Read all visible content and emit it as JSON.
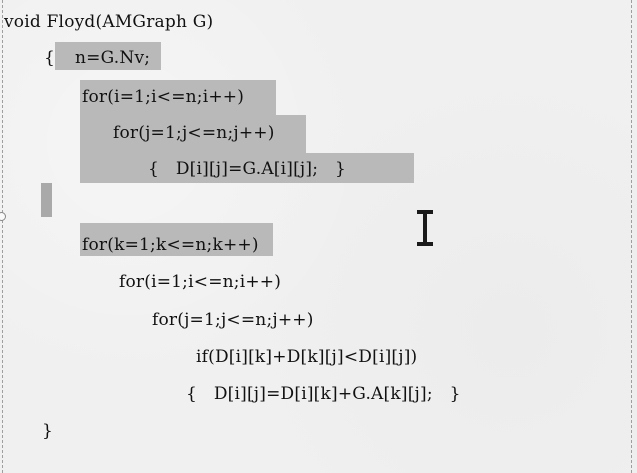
{
  "code": {
    "signature": "void Floyd(AMGraph G)",
    "open_brace": "{",
    "init_n": "n=G.Nv;",
    "init_for_i": "for(i=1;i<=n;i++)",
    "init_for_j": "for(j=1;j<=n;j++)",
    "init_body": "{   D[i][j]=G.A[i][j];   }",
    "main_for_k": "for(k=1;k<=n;k++)",
    "main_for_i": "for(i=1;i<=n;i++)",
    "main_for_j": "for(j=1;j<=n;j++)",
    "main_if": "if(D[i][k]+D[k][j]<D[i][j])",
    "main_body": "{   D[i][j]=D[i][k]+G.A[k][j];   }",
    "close_brace": "}"
  },
  "cursor": {
    "type": "i-beam-icon"
  },
  "colors": {
    "background": "#efefef",
    "selection": "#b9b9b9",
    "text": "#111111"
  }
}
